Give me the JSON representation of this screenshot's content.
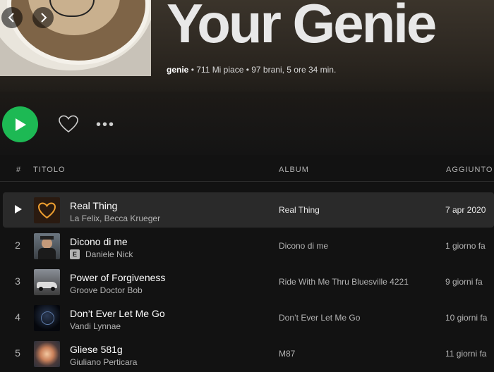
{
  "playlist": {
    "title": "Your Genie",
    "owner": "genie",
    "stats": "• 711 Mi piace • 97 brani, 5 ore 34 min."
  },
  "nav": {
    "back_icon": "chevron-left-icon",
    "forward_icon": "chevron-right-icon"
  },
  "actions": {
    "play_icon": "play-icon",
    "like_icon": "heart-icon",
    "more_label": "•••"
  },
  "columns": {
    "num": "#",
    "title": "TITOLO",
    "album": "ALBUM",
    "added": "AGGIUNTO"
  },
  "tracks": [
    {
      "num": "1",
      "name": "Real Thing",
      "artist": "La Felix, Becca Krueger",
      "explicit": false,
      "album": "Real Thing",
      "added": "7 apr 2020"
    },
    {
      "num": "2",
      "name": "Dicono di me",
      "artist": "Daniele Nick",
      "explicit": true,
      "explicit_label": "E",
      "album": "Dicono di me",
      "added": "1 giorno fa"
    },
    {
      "num": "3",
      "name": "Power of Forgiveness",
      "artist": "Groove Doctor Bob",
      "explicit": false,
      "album": "Ride With Me Thru Bluesville 4221",
      "added": "9 giorni fa"
    },
    {
      "num": "4",
      "name": "Don’t Ever Let Me Go",
      "artist": "Vandi Lynnae",
      "explicit": false,
      "album": "Don’t Ever Let Me Go",
      "added": "10 giorni fa"
    },
    {
      "num": "5",
      "name": "Gliese 581g",
      "artist": "Giuliano Perticara",
      "explicit": false,
      "album": "M87",
      "added": "11 giorni fa"
    }
  ],
  "colors": {
    "accent": "#1db954",
    "background": "#121212",
    "row_highlight": "#2a2a2a"
  }
}
